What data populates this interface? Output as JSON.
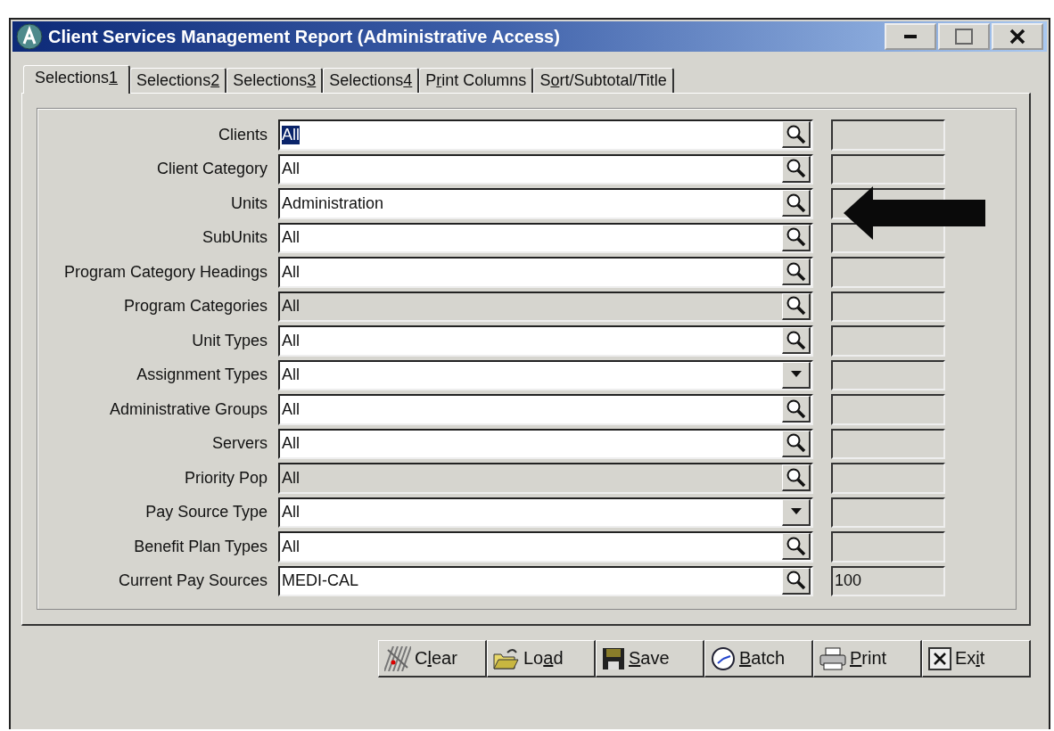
{
  "window": {
    "title": "Client Services Management Report (Administrative Access)"
  },
  "tabs": [
    {
      "pre": "Selections",
      "key": "1",
      "selected": true
    },
    {
      "pre": "Selections",
      "key": "2",
      "selected": false
    },
    {
      "pre": "Selections",
      "key": "3",
      "selected": false
    },
    {
      "pre": "Selections",
      "key": "4",
      "selected": false
    },
    {
      "pre": "P",
      "key": "r",
      "post": "int Columns",
      "selected": false
    },
    {
      "pre": "S",
      "key": "o",
      "post": "rt/Subtotal/Title",
      "selected": false
    }
  ],
  "fields": [
    {
      "label": "Clients",
      "value": "All",
      "kind": "lookup",
      "disabled": false,
      "highlighted": true
    },
    {
      "label": "Client Category",
      "value": "All",
      "kind": "lookup",
      "disabled": false,
      "highlighted": false
    },
    {
      "label": "Units",
      "value": "Administration",
      "kind": "lookup",
      "disabled": false,
      "highlighted": false
    },
    {
      "label": "SubUnits",
      "value": "All",
      "kind": "lookup",
      "disabled": false,
      "highlighted": false
    },
    {
      "label": "Program Category Headings",
      "value": "All",
      "kind": "lookup",
      "disabled": false,
      "highlighted": false
    },
    {
      "label": "Program Categories",
      "value": "All",
      "kind": "lookup",
      "disabled": true,
      "highlighted": false
    },
    {
      "label": "Unit Types",
      "value": "All",
      "kind": "lookup",
      "disabled": false,
      "highlighted": false
    },
    {
      "label": "Assignment Types",
      "value": "All",
      "kind": "dropdown",
      "disabled": false,
      "highlighted": false
    },
    {
      "label": "Administrative Groups",
      "value": "All",
      "kind": "lookup",
      "disabled": false,
      "highlighted": false
    },
    {
      "label": "Servers",
      "value": "All",
      "kind": "lookup",
      "disabled": false,
      "highlighted": false
    },
    {
      "label": "Priority Pop",
      "value": "All",
      "kind": "lookup",
      "disabled": true,
      "highlighted": false
    },
    {
      "label": "Pay Source Type",
      "value": "All",
      "kind": "dropdown",
      "disabled": false,
      "highlighted": false
    },
    {
      "label": "Benefit Plan Types",
      "value": "All",
      "kind": "lookup",
      "disabled": false,
      "highlighted": false
    },
    {
      "label": "Current Pay Sources",
      "value": "MEDI-CAL",
      "kind": "lookup",
      "disabled": false,
      "highlighted": false,
      "extra": "100"
    }
  ],
  "buttons": [
    {
      "kind": "clear",
      "pre": "C",
      "key": "l",
      "post": "ear"
    },
    {
      "kind": "load",
      "pre": "Lo",
      "key": "a",
      "post": "d"
    },
    {
      "kind": "save",
      "key": "S",
      "post": "ave"
    },
    {
      "kind": "batch",
      "key": "B",
      "post": "atch"
    },
    {
      "kind": "print",
      "key": "P",
      "post": "rint"
    },
    {
      "kind": "exit",
      "pre": "Ex",
      "key": "i",
      "post": "t"
    }
  ]
}
